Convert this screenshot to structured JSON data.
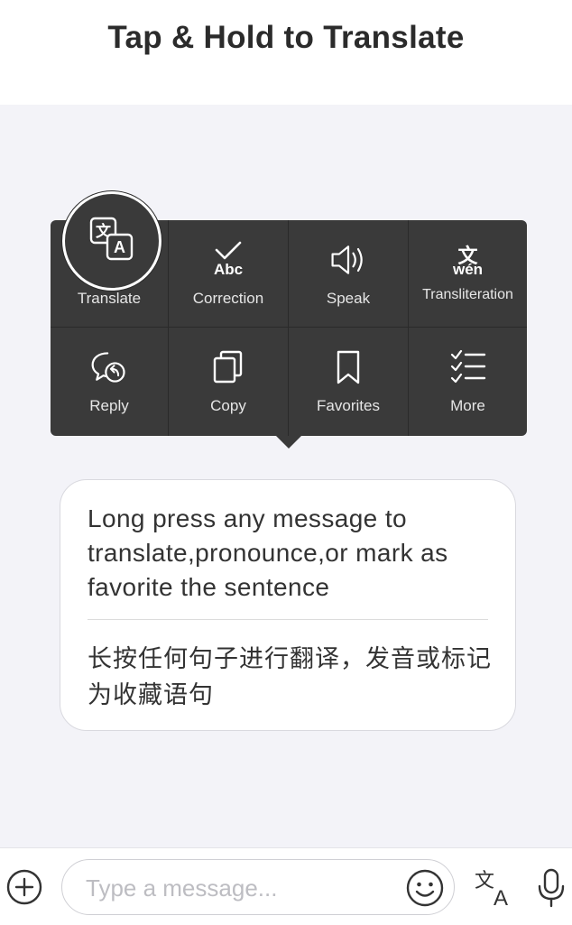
{
  "header": {
    "title": "Tap & Hold to Translate"
  },
  "context_menu": {
    "items": [
      {
        "id": "translate",
        "label": "Translate",
        "icon": "translate-icon"
      },
      {
        "id": "correction",
        "label": "Correction",
        "icon": "correction-icon",
        "icon_text": "Abc"
      },
      {
        "id": "speak",
        "label": "Speak",
        "icon": "speaker-icon"
      },
      {
        "id": "transliteration",
        "label": "Transliteration",
        "icon": "transliteration-icon",
        "icon_text_top": "文",
        "icon_text_bottom": "wén"
      },
      {
        "id": "reply",
        "label": "Reply",
        "icon": "reply-icon"
      },
      {
        "id": "copy",
        "label": "Copy",
        "icon": "copy-icon"
      },
      {
        "id": "favorites",
        "label": "Favorites",
        "icon": "bookmark-icon"
      },
      {
        "id": "more",
        "label": "More",
        "icon": "checklist-icon"
      }
    ]
  },
  "message": {
    "text_en": "Long press any message to translate,pronounce,or mark as favorite the sentence",
    "text_zh": "长按任何句子进行翻译，发音或标记为收藏语句"
  },
  "composer": {
    "placeholder": "Type a message...",
    "icons": [
      "plus-icon",
      "emoji-icon",
      "translate-icon",
      "microphone-icon"
    ]
  },
  "colors": {
    "menu_bg": "#3a3a3a",
    "page_bg": "#f3f3f8",
    "text_dark": "#333333"
  }
}
